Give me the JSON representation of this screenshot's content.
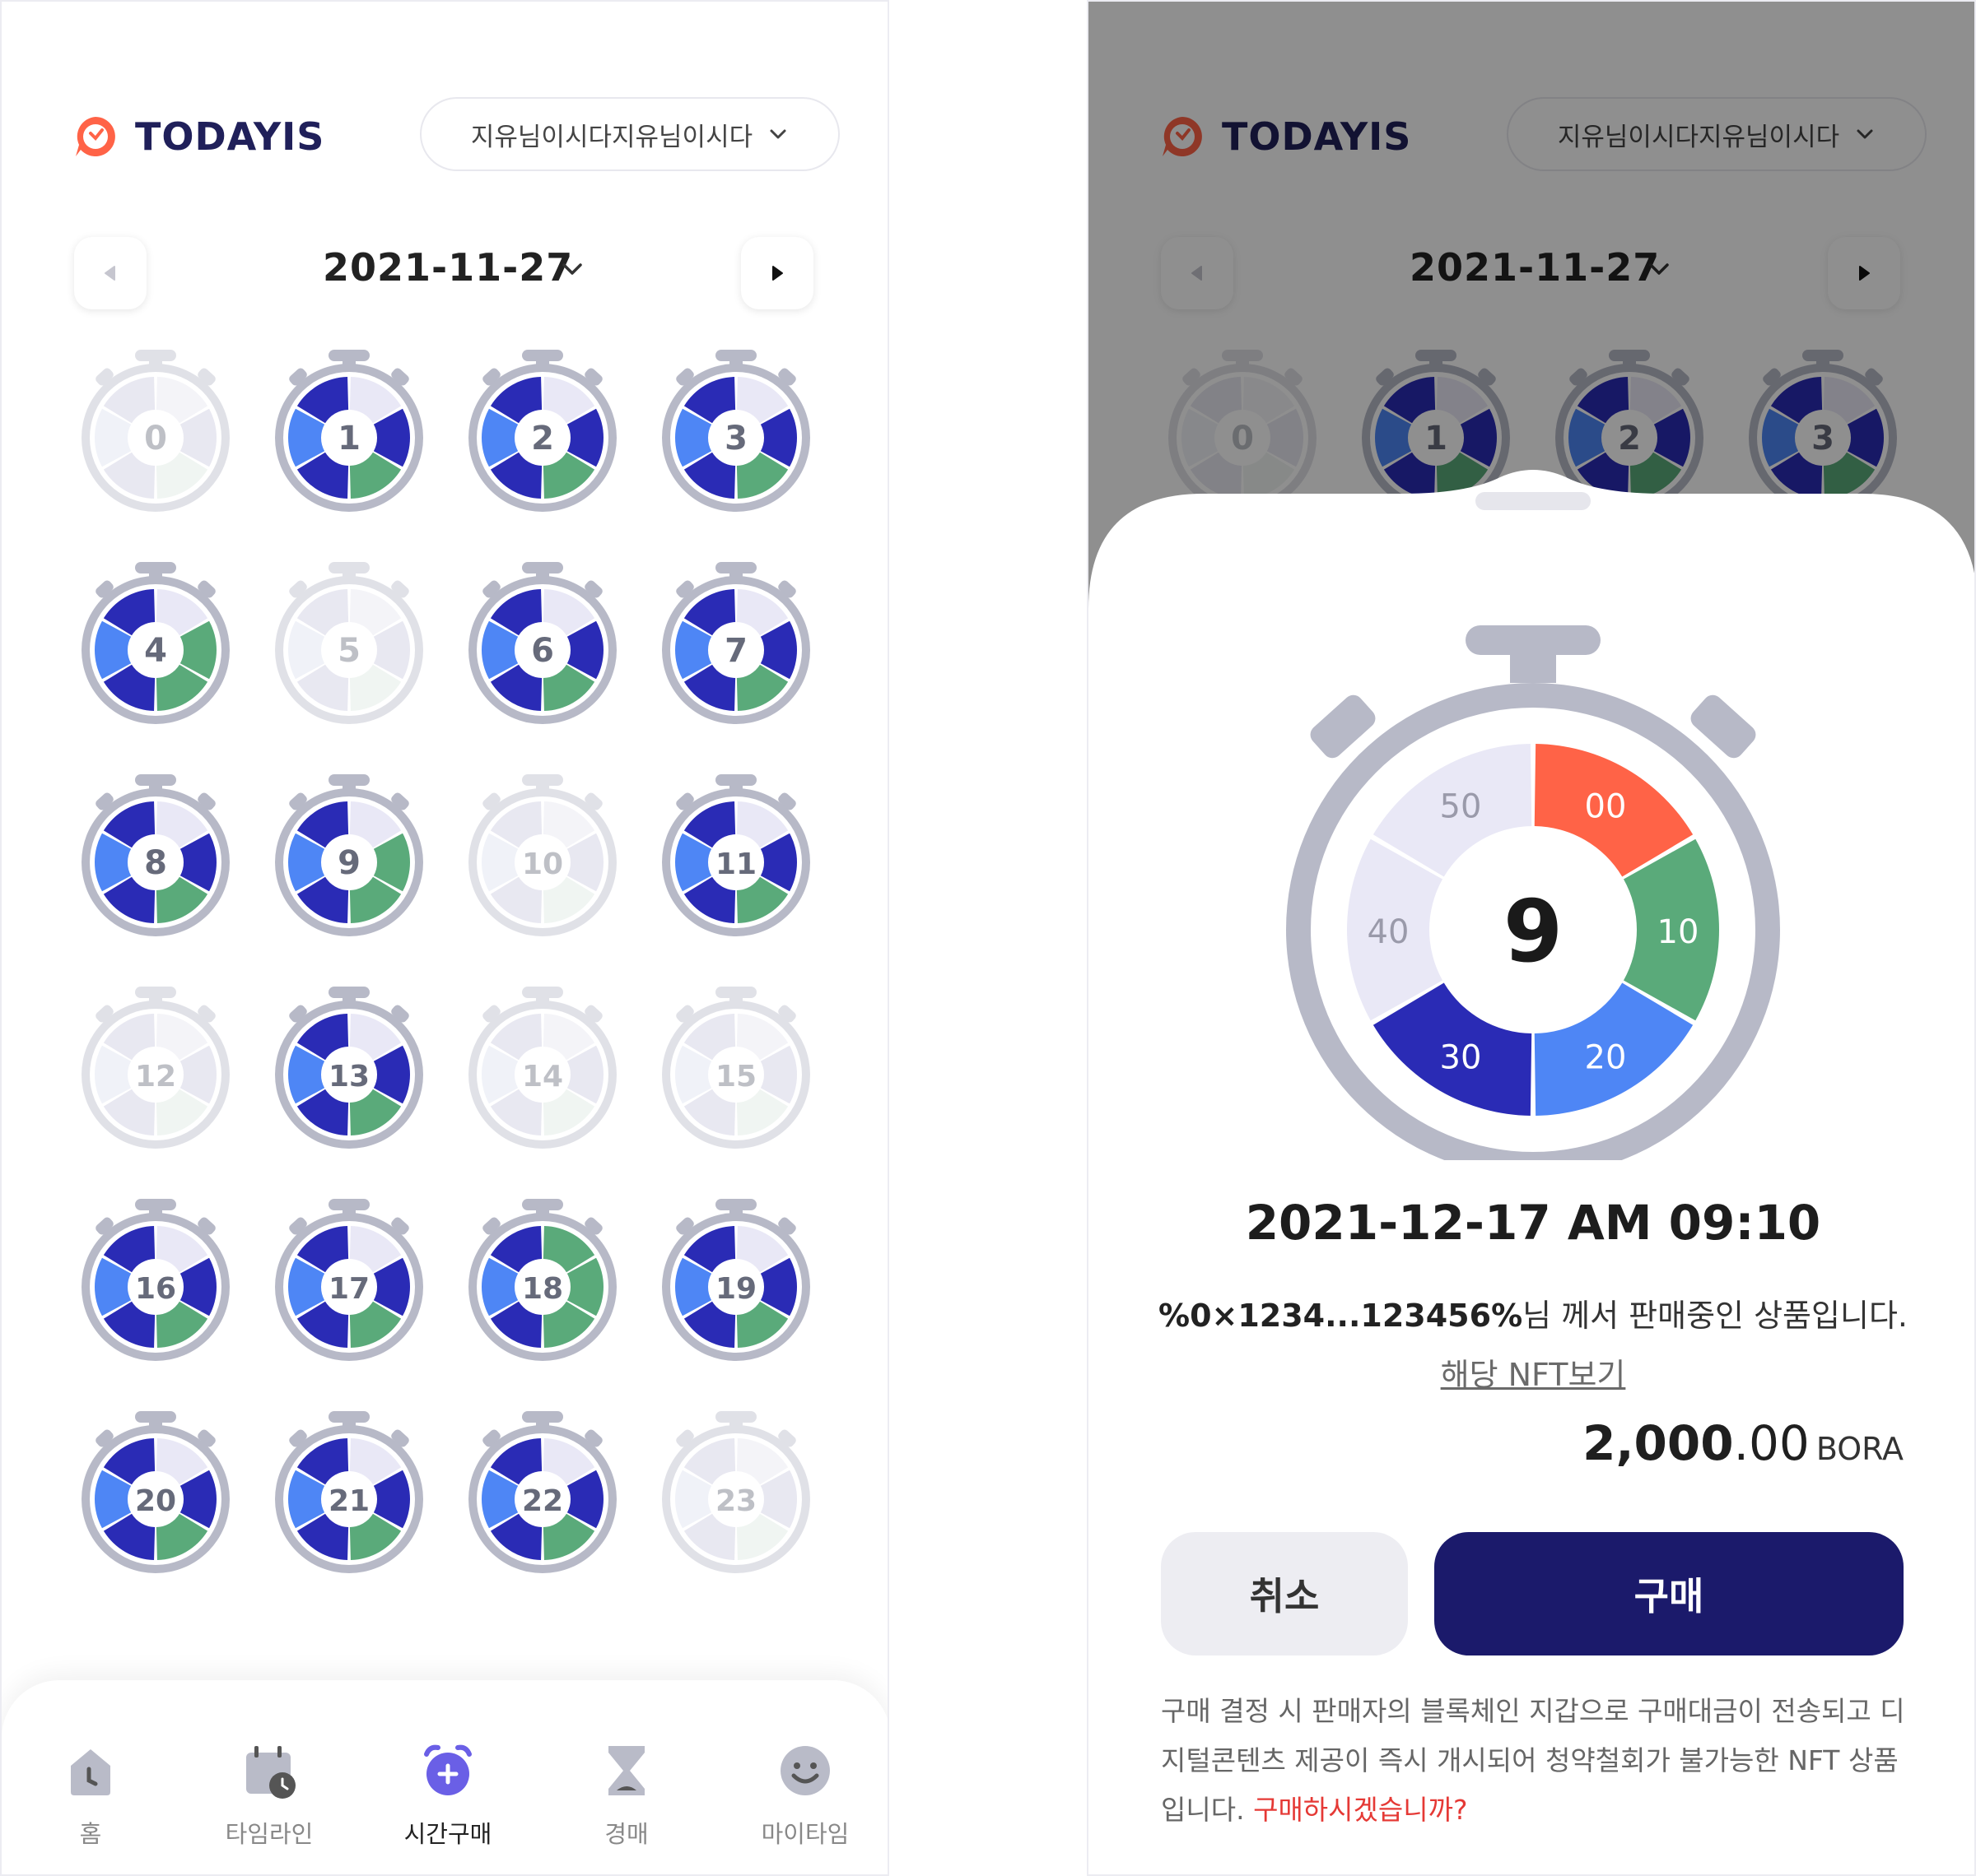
{
  "app": {
    "brand": "TODAYIS",
    "user_name": "지유님이시다지유님이시다",
    "current_date": "2021-11-27"
  },
  "colors": {
    "brand_orange": "#ff6347",
    "navy": "#1b1a6b",
    "blue_dark": "#2a2bb5",
    "blue_light": "#4e86f5",
    "green": "#5aaa7a",
    "lavender": "#e9e8f6",
    "bezel": "#b7b9c7"
  },
  "timers": [
    {
      "label": "0",
      "active": false
    },
    {
      "label": "1",
      "active": true
    },
    {
      "label": "2",
      "active": true
    },
    {
      "label": "3",
      "active": true
    },
    {
      "label": "4",
      "active": true
    },
    {
      "label": "5",
      "active": false
    },
    {
      "label": "6",
      "active": true
    },
    {
      "label": "7",
      "active": true
    },
    {
      "label": "8",
      "active": true
    },
    {
      "label": "9",
      "active": true
    },
    {
      "label": "10",
      "active": false
    },
    {
      "label": "11",
      "active": true
    },
    {
      "label": "12",
      "active": false
    },
    {
      "label": "13",
      "active": true
    },
    {
      "label": "14",
      "active": false
    },
    {
      "label": "15",
      "active": false
    },
    {
      "label": "16",
      "active": true
    },
    {
      "label": "17",
      "active": true
    },
    {
      "label": "18",
      "active": true
    },
    {
      "label": "19",
      "active": true
    },
    {
      "label": "20",
      "active": true
    },
    {
      "label": "21",
      "active": true
    },
    {
      "label": "22",
      "active": true
    },
    {
      "label": "23",
      "active": false
    }
  ],
  "bottom_nav": [
    {
      "label": "홈",
      "icon": "home-icon",
      "active": false
    },
    {
      "label": "타임라인",
      "icon": "calendar-clock-icon",
      "active": false
    },
    {
      "label": "시간구매",
      "icon": "alarm-plus-icon",
      "active": true
    },
    {
      "label": "경매",
      "icon": "hourglass-icon",
      "active": false
    },
    {
      "label": "마이타임",
      "icon": "smile-icon",
      "active": false
    }
  ],
  "sheet": {
    "hour": "9",
    "segments": [
      {
        "label": "00",
        "color": "#ff6347"
      },
      {
        "label": "10",
        "color": "#5aaa7a"
      },
      {
        "label": "20",
        "color": "#4e86f5"
      },
      {
        "label": "30",
        "color": "#2a2bb5"
      },
      {
        "label": "40",
        "color": "#e9e8f6"
      },
      {
        "label": "50",
        "color": "#e9e8f6"
      }
    ],
    "slot_time": "2021-12-17 AM 09:10",
    "seller_address": "%0×1234...123456%",
    "seller_suffix": "님 께서 판매중인 상품입니다.",
    "nft_link": "해당 NFT보기",
    "price_int": "2,000",
    "price_dec": ".00",
    "price_unit": "BORA",
    "cancel_label": "취소",
    "buy_label": "구매",
    "notice": "구매 결정 시 판매자의 블록체인 지갑으로 구매대금이 전송되고 디지털콘텐츠 제공이 즉시 개시되어 청약철회가 불가능한 NFT 상품입니다.",
    "notice_warn": "구매하시겠습니까?"
  }
}
